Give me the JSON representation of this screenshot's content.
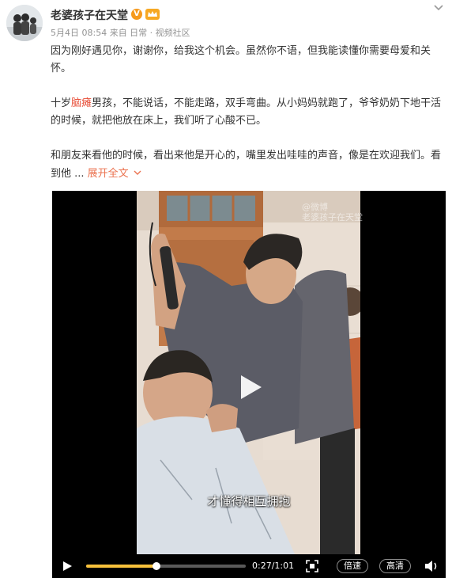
{
  "post": {
    "author": "老婆孩子在天堂",
    "verified_mark": "V",
    "meta": "5月4日 08:54 来自 日常 · 视频社区",
    "paragraphs": [
      {
        "before": "因为刚好遇见你，谢谢你，给我这个机会。虽然你不语，但我能读懂你需要母爱和关怀。",
        "highlight": "",
        "after": ""
      },
      {
        "before": "十岁",
        "highlight": "脑瘫",
        "after": "男孩，不能说话，不能走路，双手弯曲。从小妈妈就跑了，爷爷奶奶下地干活的时候，就把他放在床上，我们听了心酸不已。"
      },
      {
        "before": "和朋友来看他的时候，看出来他是开心的，嘴里发出哇哇的声音，像是在欢迎我们。看到他 ...",
        "highlight": "",
        "after": ""
      }
    ],
    "expand_label": "展开全文",
    "expand_icon": "chevron-down"
  },
  "video": {
    "watermark_line1": "@微博",
    "watermark_line2": "老婆孩子在天堂",
    "subtitle": "才懂得相互拥抱",
    "play_icon": "play",
    "controls": {
      "time": "0:27/1:01",
      "progress": 0.443,
      "speed_label": "倍速",
      "quality_label": "高清",
      "accent": "#f7c13b"
    }
  },
  "colors": {
    "highlight": "#e8503a",
    "link": "#eb7350",
    "meta": "#939393",
    "text": "#333333"
  }
}
